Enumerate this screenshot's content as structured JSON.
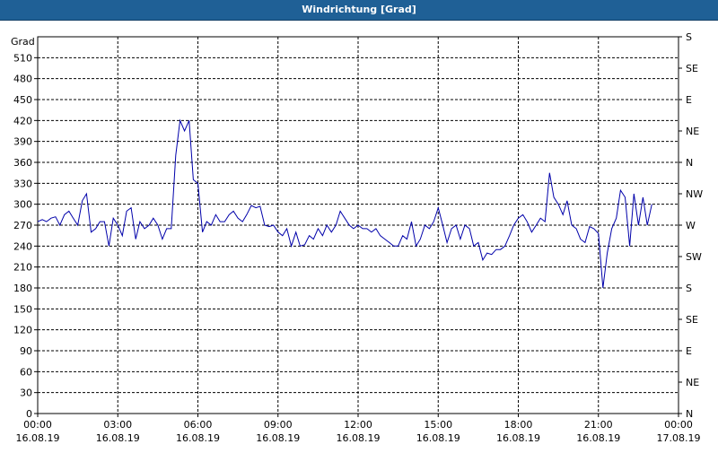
{
  "window": {
    "title": "Windrichtung [Grad]"
  },
  "colors": {
    "titlebar": "#1f6096",
    "line": "#0000aa",
    "grid": "#000000"
  },
  "chart_data": {
    "type": "line",
    "title": "Windrichtung [Grad]",
    "ylabel": "Grad",
    "xlabel": "",
    "ylim": [
      0,
      540
    ],
    "xlim": [
      "16.08.19 00:00",
      "17.08.19 00:00"
    ],
    "grid": true,
    "y_ticks": [
      0,
      30,
      60,
      90,
      120,
      150,
      180,
      210,
      240,
      270,
      300,
      330,
      360,
      390,
      420,
      450,
      480,
      510
    ],
    "y_tick_labels": [
      "0",
      "30",
      "60",
      "90",
      "120",
      "150",
      "180",
      "210",
      "240",
      "270",
      "300",
      "330",
      "360",
      "390",
      "420",
      "450",
      "480",
      "510"
    ],
    "right_axis": {
      "ticks": [
        0,
        45,
        90,
        135,
        180,
        225,
        270,
        315,
        360,
        405,
        450,
        495,
        540
      ],
      "labels": [
        "N",
        "NE",
        "E",
        "SE",
        "S",
        "SW",
        "W",
        "NW",
        "N",
        "NE",
        "E",
        "SE",
        "S"
      ]
    },
    "x_ticks": [
      {
        "time": "00:00",
        "date": "16.08.19"
      },
      {
        "time": "03:00",
        "date": "16.08.19"
      },
      {
        "time": "06:00",
        "date": "16.08.19"
      },
      {
        "time": "09:00",
        "date": "16.08.19"
      },
      {
        "time": "12:00",
        "date": "16.08.19"
      },
      {
        "time": "15:00",
        "date": "16.08.19"
      },
      {
        "time": "18:00",
        "date": "16.08.19"
      },
      {
        "time": "21:00",
        "date": "16.08.19"
      },
      {
        "time": "00:00",
        "date": "17.08.19"
      }
    ],
    "series": [
      {
        "x_hours": [
          0,
          0.17,
          0.33,
          0.5,
          0.67,
          0.83,
          1,
          1.17,
          1.33,
          1.5,
          1.67,
          1.83,
          2,
          2.17,
          2.33,
          2.5,
          2.67,
          2.83,
          3,
          3.17,
          3.33,
          3.5,
          3.67,
          3.83,
          4,
          4.17,
          4.33,
          4.5,
          4.67,
          4.83,
          5,
          5.17,
          5.33,
          5.5,
          5.67,
          5.83,
          6,
          6.17,
          6.33,
          6.5,
          6.67,
          6.83,
          7,
          7.17,
          7.33,
          7.5,
          7.67,
          7.83,
          8,
          8.17,
          8.33,
          8.5,
          8.67,
          8.83,
          9,
          9.17,
          9.33,
          9.5,
          9.67,
          9.83,
          10,
          10.17,
          10.33,
          10.5,
          10.67,
          10.83,
          11,
          11.17,
          11.33,
          11.5,
          11.67,
          11.83,
          12,
          12.17,
          12.33,
          12.5,
          12.67,
          12.83,
          13,
          13.17,
          13.33,
          13.5,
          13.67,
          13.83,
          14,
          14.17,
          14.33,
          14.5,
          14.67,
          14.83,
          15,
          15.17,
          15.33,
          15.5,
          15.67,
          15.83,
          16,
          16.17,
          16.33,
          16.5,
          16.67,
          16.83,
          17,
          17.17,
          17.33,
          17.5,
          17.67,
          17.83,
          18,
          18.17,
          18.33,
          18.5,
          18.67,
          18.83,
          19,
          19.17,
          19.33,
          19.5,
          19.67,
          19.83,
          20,
          20.17,
          20.33,
          20.5,
          20.67,
          20.83,
          21,
          21.17,
          21.33,
          21.5,
          21.67,
          21.83,
          22,
          22.17,
          22.33,
          22.5,
          22.67,
          22.83,
          23,
          23.17,
          23.33,
          23.5,
          23.67,
          23.83,
          24
        ],
        "values": [
          275,
          278,
          275,
          280,
          282,
          270,
          285,
          290,
          280,
          270,
          305,
          315,
          260,
          265,
          275,
          275,
          240,
          280,
          270,
          255,
          290,
          295,
          250,
          275,
          265,
          270,
          280,
          270,
          250,
          265,
          265,
          370,
          420,
          405,
          420,
          335,
          330,
          260,
          275,
          270,
          285,
          275,
          275,
          285,
          290,
          280,
          275,
          285,
          298,
          295,
          297,
          270,
          268,
          270,
          260,
          255,
          265,
          240,
          260,
          240,
          242,
          255,
          250,
          265,
          255,
          270,
          260,
          270,
          290,
          280,
          270,
          265,
          270,
          265,
          265,
          260,
          265,
          255,
          250,
          245,
          240,
          240,
          255,
          250,
          275,
          240,
          250,
          270,
          265,
          275,
          295,
          270,
          245,
          265,
          270,
          250,
          270,
          265,
          240,
          245,
          220,
          230,
          228,
          235,
          235,
          240,
          255,
          270,
          280,
          285,
          275,
          260,
          270,
          280,
          275,
          345,
          310,
          300,
          285,
          305,
          270,
          265,
          250,
          245,
          268,
          265,
          258,
          180,
          230,
          265,
          280,
          320,
          310,
          240,
          315,
          270,
          310,
          270,
          300
        ]
      }
    ]
  }
}
